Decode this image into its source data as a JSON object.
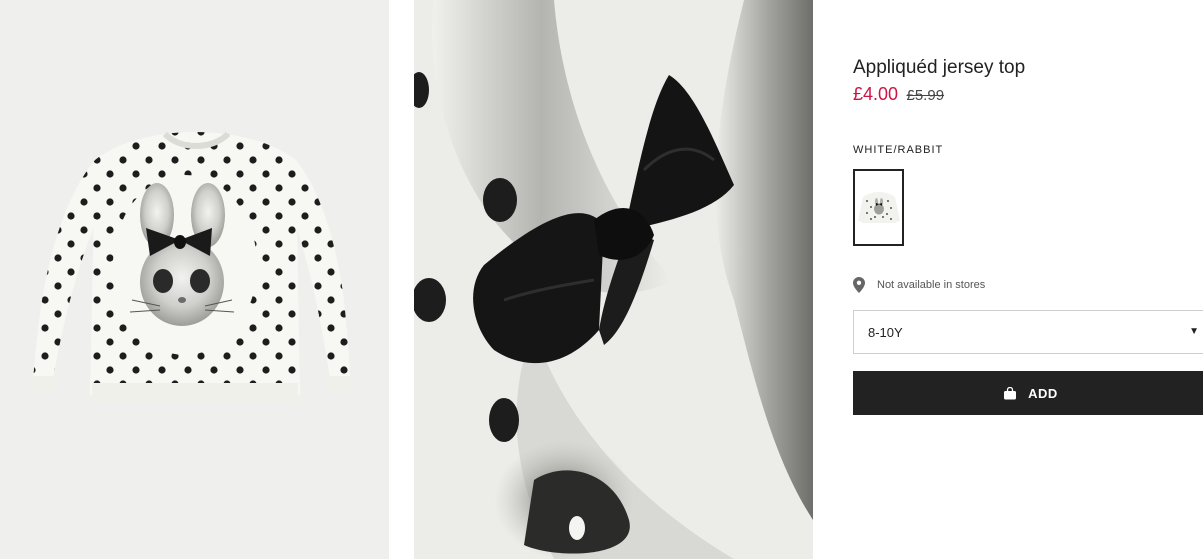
{
  "product": {
    "title": "Appliquéd jersey top",
    "price_sale": "£4.00",
    "price_original": "£5.99",
    "color_label": "WHITE/RABBIT",
    "store_availability": "Not available in stores",
    "size_selected": "8-10Y",
    "add_label": "ADD"
  },
  "colors": {
    "sale": "#d01345",
    "button": "#222222"
  },
  "icons": {
    "location": "map-pin-icon",
    "bag": "shopping-bag-icon",
    "dropdown": "chevron-down-icon"
  }
}
